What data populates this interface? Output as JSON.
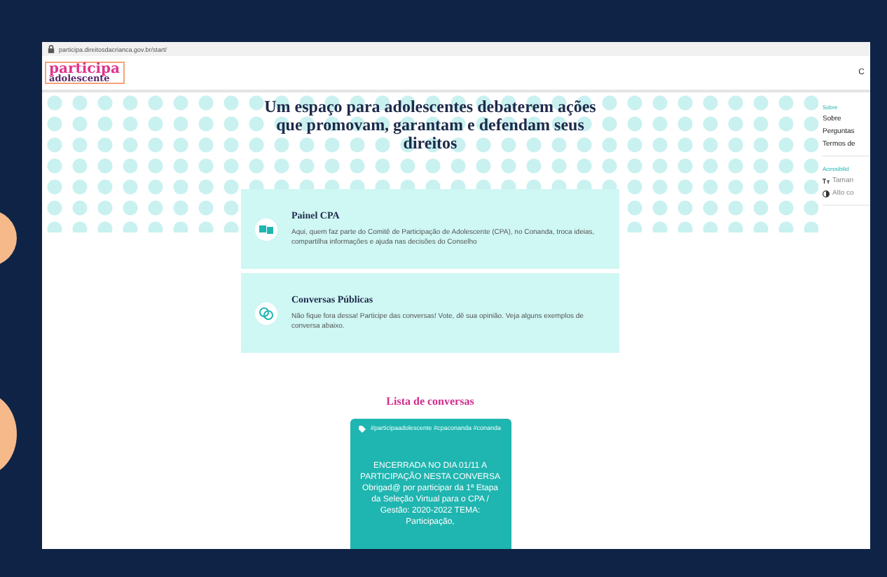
{
  "browser": {
    "url": "participa.direitosdacrianca.gov.br/start/"
  },
  "header": {
    "logo_top": "participa",
    "logo_bottom": "adolescente",
    "right_text": "C"
  },
  "hero": {
    "title": "Um espaço para adolescentes debaterem ações que promovam, garantam e defendam seus direitos"
  },
  "cards": [
    {
      "kind": "panel",
      "title": "Painel CPA",
      "text": "Aqui, quem faz parte do Comitê de Participação de Adolescente (CPA), no Conanda, troca ideias, compartilha informações e ajuda nas decisões do Conselho"
    },
    {
      "kind": "chat",
      "title": "Conversas Públicas",
      "text": "Não fique fora dessa! Participe das conversas! Vote, dê sua opinião. Veja alguns exemplos de conversa abaixo."
    }
  ],
  "conversations": {
    "heading": "Lista de conversas",
    "items": [
      {
        "tags": "#participaadolescente #cpaconanda #conanda",
        "text": "ENCERRADA NO DIA 01/11 A PARTICIPAÇÃO NESTA CONVERSA Obrigad@ por participar da 1ª Etapa da Seleção Virtual para o CPA / Gestão: 2020-2022 TEMA: Participação,"
      }
    ]
  },
  "sidebar": {
    "sections": [
      {
        "heading": "Sobre",
        "items": [
          {
            "kind": "link",
            "label": "Sobre"
          },
          {
            "kind": "link",
            "label": "Perguntas"
          },
          {
            "kind": "link",
            "label": "Termos de"
          }
        ]
      },
      {
        "heading": "Acessibilid",
        "items": [
          {
            "kind": "text-size",
            "label": "Taman"
          },
          {
            "kind": "contrast",
            "label": "Alto co"
          }
        ]
      }
    ]
  }
}
